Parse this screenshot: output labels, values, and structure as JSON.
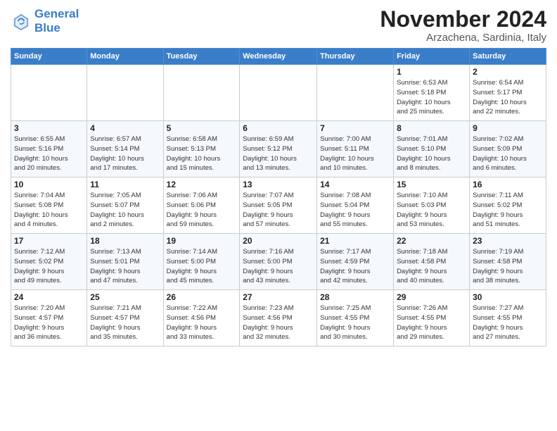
{
  "logo": {
    "line1": "General",
    "line2": "Blue"
  },
  "title": "November 2024",
  "subtitle": "Arzachena, Sardinia, Italy",
  "weekdays": [
    "Sunday",
    "Monday",
    "Tuesday",
    "Wednesday",
    "Thursday",
    "Friday",
    "Saturday"
  ],
  "weeks": [
    [
      {
        "day": "",
        "info": ""
      },
      {
        "day": "",
        "info": ""
      },
      {
        "day": "",
        "info": ""
      },
      {
        "day": "",
        "info": ""
      },
      {
        "day": "",
        "info": ""
      },
      {
        "day": "1",
        "info": "Sunrise: 6:53 AM\nSunset: 5:18 PM\nDaylight: 10 hours\nand 25 minutes."
      },
      {
        "day": "2",
        "info": "Sunrise: 6:54 AM\nSunset: 5:17 PM\nDaylight: 10 hours\nand 22 minutes."
      }
    ],
    [
      {
        "day": "3",
        "info": "Sunrise: 6:55 AM\nSunset: 5:16 PM\nDaylight: 10 hours\nand 20 minutes."
      },
      {
        "day": "4",
        "info": "Sunrise: 6:57 AM\nSunset: 5:14 PM\nDaylight: 10 hours\nand 17 minutes."
      },
      {
        "day": "5",
        "info": "Sunrise: 6:58 AM\nSunset: 5:13 PM\nDaylight: 10 hours\nand 15 minutes."
      },
      {
        "day": "6",
        "info": "Sunrise: 6:59 AM\nSunset: 5:12 PM\nDaylight: 10 hours\nand 13 minutes."
      },
      {
        "day": "7",
        "info": "Sunrise: 7:00 AM\nSunset: 5:11 PM\nDaylight: 10 hours\nand 10 minutes."
      },
      {
        "day": "8",
        "info": "Sunrise: 7:01 AM\nSunset: 5:10 PM\nDaylight: 10 hours\nand 8 minutes."
      },
      {
        "day": "9",
        "info": "Sunrise: 7:02 AM\nSunset: 5:09 PM\nDaylight: 10 hours\nand 6 minutes."
      }
    ],
    [
      {
        "day": "10",
        "info": "Sunrise: 7:04 AM\nSunset: 5:08 PM\nDaylight: 10 hours\nand 4 minutes."
      },
      {
        "day": "11",
        "info": "Sunrise: 7:05 AM\nSunset: 5:07 PM\nDaylight: 10 hours\nand 2 minutes."
      },
      {
        "day": "12",
        "info": "Sunrise: 7:06 AM\nSunset: 5:06 PM\nDaylight: 9 hours\nand 59 minutes."
      },
      {
        "day": "13",
        "info": "Sunrise: 7:07 AM\nSunset: 5:05 PM\nDaylight: 9 hours\nand 57 minutes."
      },
      {
        "day": "14",
        "info": "Sunrise: 7:08 AM\nSunset: 5:04 PM\nDaylight: 9 hours\nand 55 minutes."
      },
      {
        "day": "15",
        "info": "Sunrise: 7:10 AM\nSunset: 5:03 PM\nDaylight: 9 hours\nand 53 minutes."
      },
      {
        "day": "16",
        "info": "Sunrise: 7:11 AM\nSunset: 5:02 PM\nDaylight: 9 hours\nand 51 minutes."
      }
    ],
    [
      {
        "day": "17",
        "info": "Sunrise: 7:12 AM\nSunset: 5:02 PM\nDaylight: 9 hours\nand 49 minutes."
      },
      {
        "day": "18",
        "info": "Sunrise: 7:13 AM\nSunset: 5:01 PM\nDaylight: 9 hours\nand 47 minutes."
      },
      {
        "day": "19",
        "info": "Sunrise: 7:14 AM\nSunset: 5:00 PM\nDaylight: 9 hours\nand 45 minutes."
      },
      {
        "day": "20",
        "info": "Sunrise: 7:16 AM\nSunset: 5:00 PM\nDaylight: 9 hours\nand 43 minutes."
      },
      {
        "day": "21",
        "info": "Sunrise: 7:17 AM\nSunset: 4:59 PM\nDaylight: 9 hours\nand 42 minutes."
      },
      {
        "day": "22",
        "info": "Sunrise: 7:18 AM\nSunset: 4:58 PM\nDaylight: 9 hours\nand 40 minutes."
      },
      {
        "day": "23",
        "info": "Sunrise: 7:19 AM\nSunset: 4:58 PM\nDaylight: 9 hours\nand 38 minutes."
      }
    ],
    [
      {
        "day": "24",
        "info": "Sunrise: 7:20 AM\nSunset: 4:57 PM\nDaylight: 9 hours\nand 36 minutes."
      },
      {
        "day": "25",
        "info": "Sunrise: 7:21 AM\nSunset: 4:57 PM\nDaylight: 9 hours\nand 35 minutes."
      },
      {
        "day": "26",
        "info": "Sunrise: 7:22 AM\nSunset: 4:56 PM\nDaylight: 9 hours\nand 33 minutes."
      },
      {
        "day": "27",
        "info": "Sunrise: 7:23 AM\nSunset: 4:56 PM\nDaylight: 9 hours\nand 32 minutes."
      },
      {
        "day": "28",
        "info": "Sunrise: 7:25 AM\nSunset: 4:55 PM\nDaylight: 9 hours\nand 30 minutes."
      },
      {
        "day": "29",
        "info": "Sunrise: 7:26 AM\nSunset: 4:55 PM\nDaylight: 9 hours\nand 29 minutes."
      },
      {
        "day": "30",
        "info": "Sunrise: 7:27 AM\nSunset: 4:55 PM\nDaylight: 9 hours\nand 27 minutes."
      }
    ]
  ]
}
